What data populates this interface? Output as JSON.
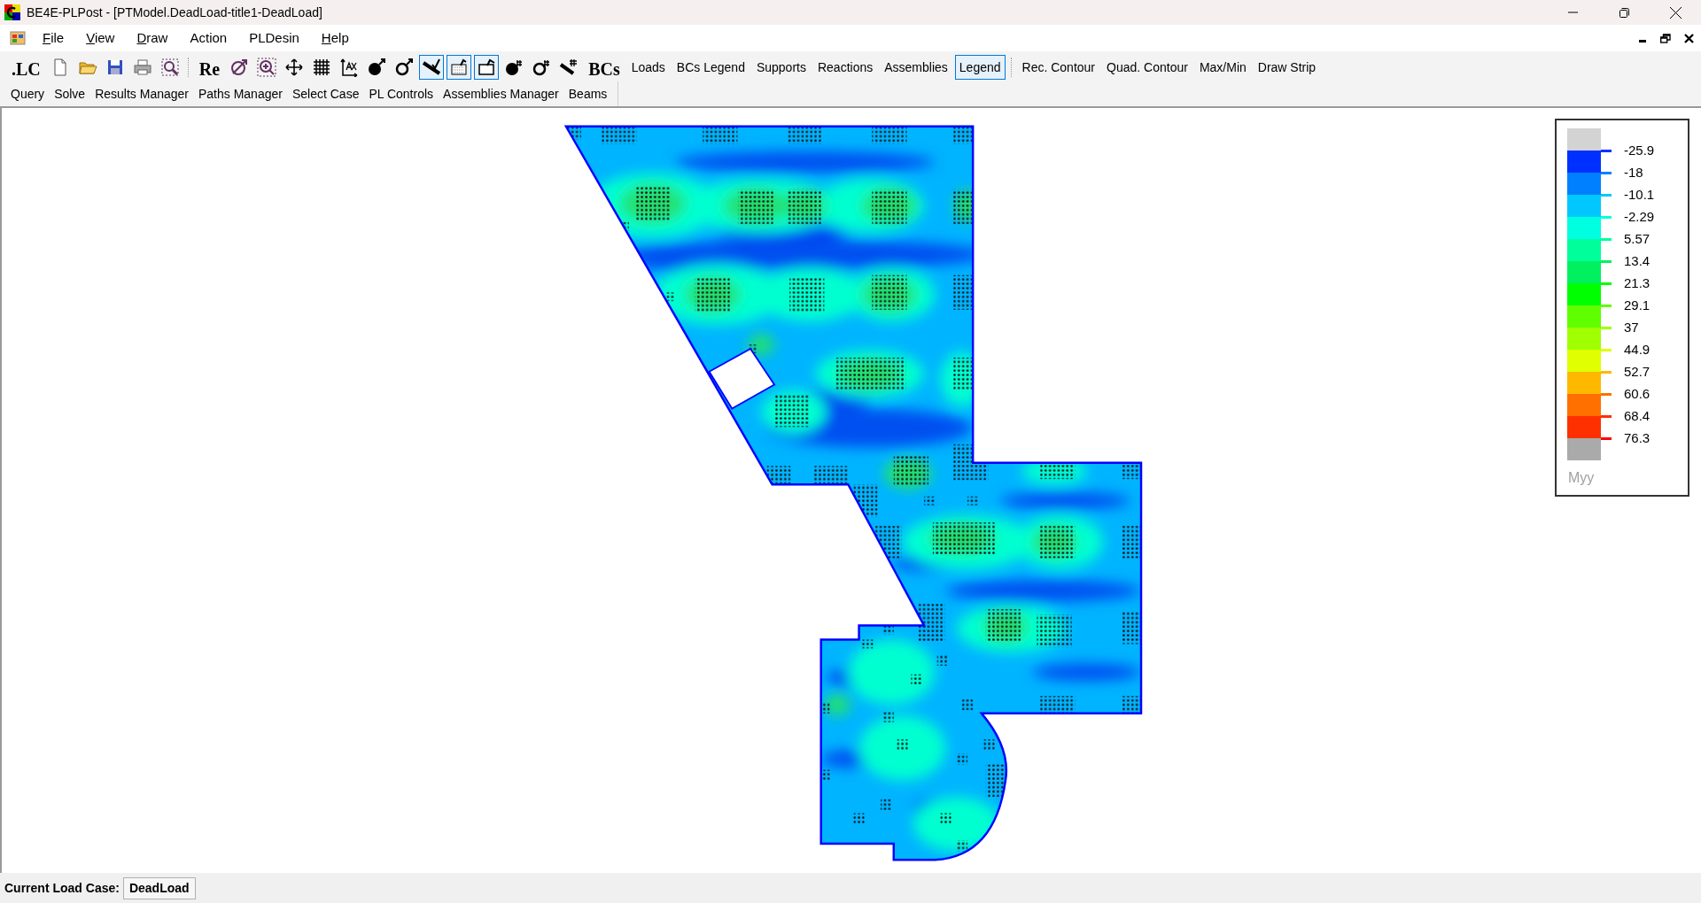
{
  "window": {
    "title": "BE4E-PLPost - [PTModel.DeadLoad-title1-DeadLoad]"
  },
  "menu": [
    {
      "label": "File",
      "underline_first": true
    },
    {
      "label": "View",
      "underline_first": true
    },
    {
      "label": "Draw",
      "underline_first": true
    },
    {
      "label": "Action",
      "underline_first": false
    },
    {
      "label": "PLDesin",
      "underline_first": false
    },
    {
      "label": "Help",
      "underline_first": true
    }
  ],
  "toolbar": [
    {
      "kind": "bold",
      "label": ".LC",
      "selected": false
    },
    {
      "kind": "icon",
      "selected": false
    },
    {
      "kind": "icon",
      "selected": false
    },
    {
      "kind": "icon",
      "selected": false
    },
    {
      "kind": "icon",
      "selected": false
    },
    {
      "kind": "icon",
      "selected": false
    },
    {
      "kind": "separator"
    },
    {
      "kind": "bold",
      "label": "Re",
      "selected": false
    },
    {
      "kind": "icon",
      "selected": false
    },
    {
      "kind": "icon",
      "selected": false
    },
    {
      "kind": "icon",
      "selected": false
    },
    {
      "kind": "icon",
      "selected": false
    },
    {
      "kind": "icon",
      "selected": false
    },
    {
      "kind": "icon",
      "selected": false
    },
    {
      "kind": "icon",
      "selected": false
    },
    {
      "kind": "icon",
      "selected": true
    },
    {
      "kind": "icon",
      "selected": true
    },
    {
      "kind": "icon",
      "selected": true
    },
    {
      "kind": "icon",
      "selected": false
    },
    {
      "kind": "icon",
      "selected": false
    },
    {
      "kind": "icon",
      "selected": false
    },
    {
      "kind": "bold",
      "label": "BCs",
      "selected": false
    },
    {
      "kind": "text",
      "label": "Loads",
      "selected": false
    },
    {
      "kind": "text",
      "label": "BCs Legend",
      "selected": false
    },
    {
      "kind": "text",
      "label": "Supports",
      "selected": false
    },
    {
      "kind": "text",
      "label": "Reactions",
      "selected": false
    },
    {
      "kind": "text",
      "label": "Assemblies",
      "selected": false
    },
    {
      "kind": "text",
      "label": "Legend",
      "selected": true
    },
    {
      "kind": "separator"
    },
    {
      "kind": "text",
      "label": "Rec. Contour",
      "selected": false
    },
    {
      "kind": "text",
      "label": "Quad. Contour",
      "selected": false
    },
    {
      "kind": "text",
      "label": "Max/Min",
      "selected": false
    },
    {
      "kind": "text",
      "label": "Draw Strip",
      "selected": false
    }
  ],
  "toolbar_2": [
    "Query",
    "Solve",
    "Results Manager",
    "Paths Manager",
    "Select Case",
    "PL Controls",
    "Assemblies Manager",
    "Beams"
  ],
  "legend": {
    "title": "Myy",
    "entries": [
      {
        "label": "-25.9",
        "color": "#0030ff"
      },
      {
        "label": "-18",
        "color": "#0080ff"
      },
      {
        "label": "-10.1",
        "color": "#00c8ff"
      },
      {
        "label": "-2.29",
        "color": "#00ffe0"
      },
      {
        "label": "5.57",
        "color": "#00ff9a"
      },
      {
        "label": "13.4",
        "color": "#00f060"
      },
      {
        "label": "21.3",
        "color": "#00ff00"
      },
      {
        "label": "29.1",
        "color": "#60ff00"
      },
      {
        "label": "37",
        "color": "#a0ff00"
      },
      {
        "label": "44.9",
        "color": "#e0ff00"
      },
      {
        "label": "52.7",
        "color": "#ffb800"
      },
      {
        "label": "60.6",
        "color": "#ff7000"
      },
      {
        "label": "68.4",
        "color": "#ff3000"
      },
      {
        "label": "76.3",
        "color": "#ff0000"
      }
    ]
  },
  "status_bar": {
    "label": "Current Load Case:",
    "value": "DeadLoad"
  }
}
